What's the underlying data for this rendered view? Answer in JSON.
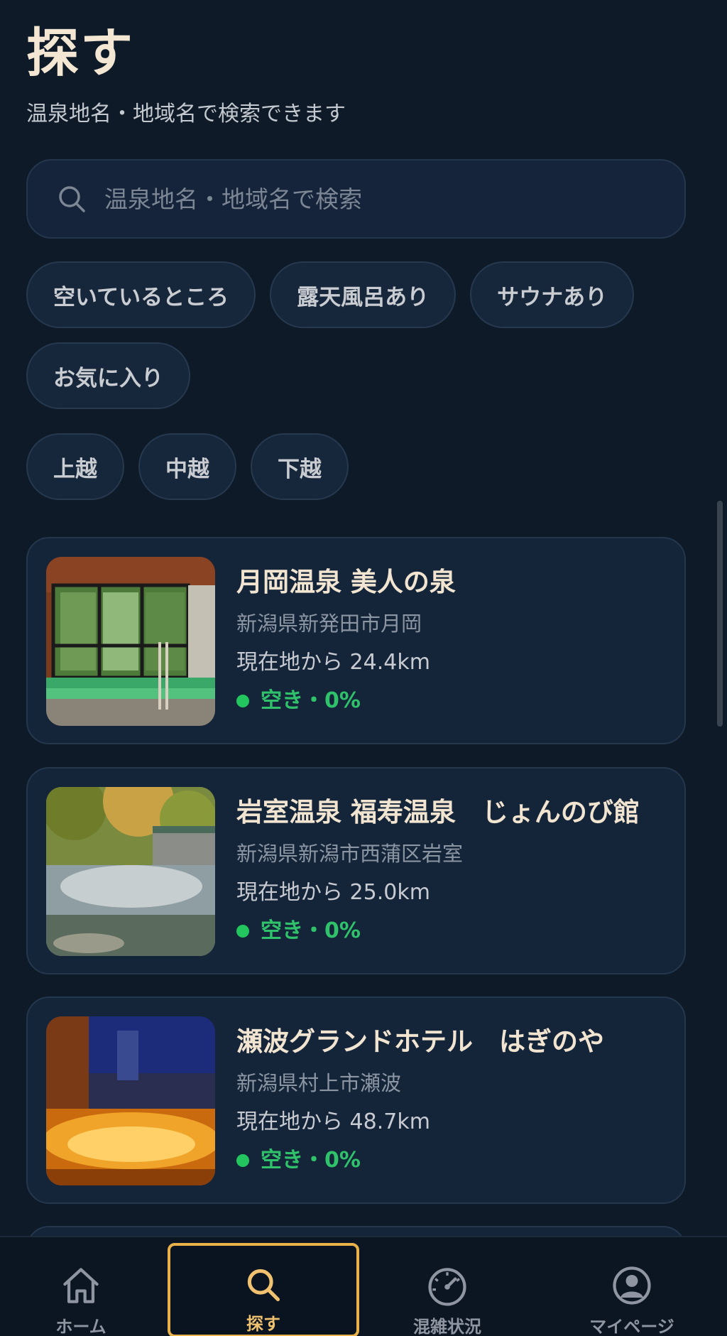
{
  "header": {
    "title": "探す",
    "subtitle": "温泉地名・地域名で検索できます"
  },
  "search": {
    "placeholder": "温泉地名・地域名で検索",
    "value": ""
  },
  "filters": {
    "chips": [
      "空いているところ",
      "露天風呂あり",
      "サウナあり",
      "お気に入り"
    ],
    "regions": [
      "上越",
      "中越",
      "下越"
    ]
  },
  "results": [
    {
      "name": "月岡温泉 美人の泉",
      "address": "新潟県新発田市月岡",
      "distance": "現在地から 24.4km",
      "status": "空き・0%"
    },
    {
      "name": "岩室温泉 福寿温泉　じょんのび館",
      "address": "新潟県新潟市西蒲区岩室",
      "distance": "現在地から 25.0km",
      "status": "空き・0%"
    },
    {
      "name": "瀬波グランドホテル　はぎのや",
      "address": "新潟県村上市瀬波",
      "distance": "現在地から 48.7km",
      "status": "空き・0%"
    }
  ],
  "nav": {
    "items": [
      {
        "label": "ホーム",
        "icon": "home-icon"
      },
      {
        "label": "探す",
        "icon": "search-icon"
      },
      {
        "label": "混雑状況",
        "icon": "gauge-icon"
      },
      {
        "label": "マイページ",
        "icon": "user-icon"
      }
    ],
    "active": "探す"
  },
  "colors": {
    "background": "#0e1a28",
    "card": "#142439",
    "accent": "#e8b14a",
    "available": "#22c55e"
  }
}
